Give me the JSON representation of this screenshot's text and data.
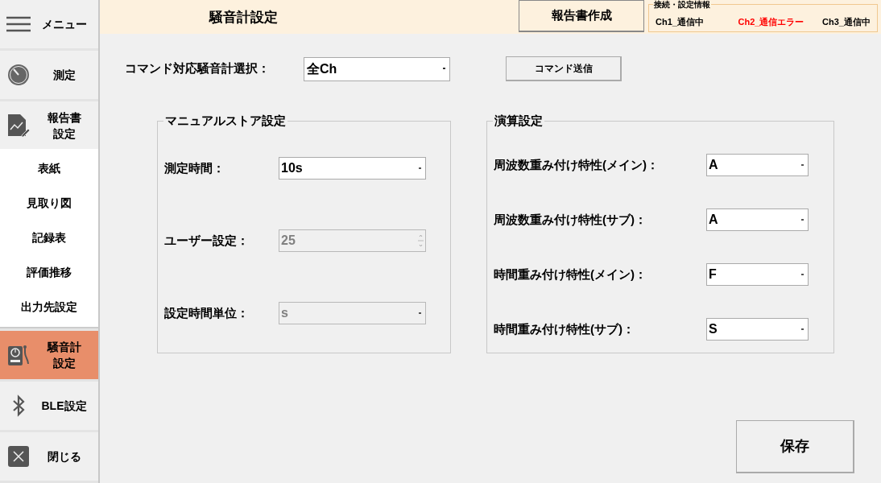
{
  "sidebar": {
    "items": [
      {
        "label": "メニュー",
        "kind": "single",
        "selected": false
      },
      {
        "label": "測定",
        "kind": "single",
        "selected": false
      },
      {
        "label": "報告書設定",
        "kind": "stacked",
        "selected": false,
        "children": [
          {
            "label": "表紙",
            "selected": false
          },
          {
            "label": "見取り図",
            "selected": false
          },
          {
            "label": "記録表",
            "selected": false
          },
          {
            "label": "評価推移",
            "selected": false
          },
          {
            "label": "出力先設定",
            "selected": false
          }
        ]
      },
      {
        "label": "騒音計設定",
        "kind": "stacked",
        "selected": true
      },
      {
        "label": "BLE設定",
        "kind": "single",
        "selected": false
      },
      {
        "label": "閉じる",
        "kind": "single",
        "selected": false
      }
    ]
  },
  "header": {
    "title": "騒音計設定",
    "report_button": "報告書作成",
    "connection_info": {
      "legend": "接続・設定情報",
      "channels": [
        {
          "label": "Ch1_通信中",
          "error": false
        },
        {
          "label": "Ch2_通信エラー",
          "error": true
        },
        {
          "label": "Ch3_通信中",
          "error": false
        }
      ]
    }
  },
  "command": {
    "label": "コマンド対応騒音計選択：",
    "select": {
      "value": "全Ch"
    },
    "button": "コマンド送信"
  },
  "manual_store": {
    "legend": "マニュアルストア設定",
    "fields": [
      {
        "label": "測定時間：",
        "value": "10s",
        "kind": "select",
        "disabled": false
      },
      {
        "label": "ユーザー設定：",
        "value": "25",
        "kind": "spinner",
        "disabled": true
      },
      {
        "label": "設定時間単位：",
        "value": "s",
        "kind": "select",
        "disabled": true
      }
    ]
  },
  "calculation": {
    "legend": "演算設定",
    "fields": [
      {
        "label": "周波数重み付け特性(メイン)：",
        "value": "A",
        "kind": "select",
        "disabled": false
      },
      {
        "label": "周波数重み付け特性(サブ)：",
        "value": "A",
        "kind": "select",
        "disabled": false
      },
      {
        "label": "時間重み付け特性(メイン)：",
        "value": "F",
        "kind": "select",
        "disabled": false
      },
      {
        "label": "時間重み付け特性(サブ)：",
        "value": "S",
        "kind": "select",
        "disabled": false
      }
    ]
  },
  "save_button": "保存"
}
